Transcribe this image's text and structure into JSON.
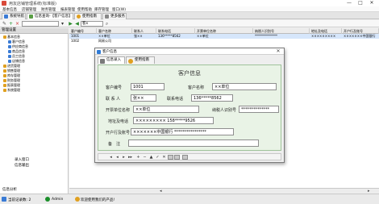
{
  "window": {
    "title": "用友店铺管理系统(标准版)",
    "min": "—",
    "max": "□",
    "close": "✕",
    "colors": {
      "app_icon": "#d94a3a"
    }
  },
  "menu": [
    "基本信息",
    "店铺管理",
    "财务管理",
    "报表管理",
    "使用帮助",
    "库存管理",
    "窗口(W)"
  ],
  "tabs": [
    {
      "label": "系统导航",
      "icon": "nav-icon",
      "color": "#3a7bd5"
    },
    {
      "label": "信息查询-【客户信息】",
      "icon": "doc-icon",
      "color": "#5a9e45"
    },
    {
      "label": "使用指南",
      "icon": "help-icon",
      "color": "#e0a020"
    },
    {
      "label": "更多服务",
      "icon": "more-icon",
      "color": "#888888"
    }
  ],
  "toolbar": {
    "icons": [
      "edit-icon",
      "add-icon",
      "delete-icon",
      "save-icon",
      "search-icon",
      "back-icon",
      "forward-icon"
    ],
    "search_value": "",
    "field_value": "客x"
  },
  "left_panel": {
    "header": "管理设置",
    "items": [
      {
        "label": "基本信息",
        "indent": 1,
        "color": "#e0a020"
      },
      {
        "label": "客户信息",
        "indent": 2,
        "color": "#3a7bd5"
      },
      {
        "label": "供应商信息",
        "indent": 2,
        "color": "#3a7bd5"
      },
      {
        "label": "商品信息",
        "indent": 2,
        "color": "#3a7bd5"
      },
      {
        "label": "员工信息",
        "indent": 2,
        "color": "#3a7bd5"
      },
      {
        "label": "店铺信息",
        "indent": 2,
        "color": "#3a7bd5"
      },
      {
        "label": "进货管理",
        "indent": 1,
        "color": "#e0a020"
      },
      {
        "label": "销售管理",
        "indent": 1,
        "color": "#e0a020"
      },
      {
        "label": "库存管理",
        "indent": 1,
        "color": "#e0a020"
      },
      {
        "label": "财务管理",
        "indent": 1,
        "color": "#e0a020"
      },
      {
        "label": "报表管理",
        "indent": 1,
        "color": "#e0a020"
      },
      {
        "label": "系统管理",
        "indent": 1,
        "color": "#e0a020"
      }
    ],
    "bottom_items": [
      "录入窗口",
      "信息输出"
    ],
    "footer": "信息分析"
  },
  "grid": {
    "columns": [
      "客户编号",
      "客户名称",
      "联系人",
      "联系电话",
      "开票单位名称",
      "纳税人识别号",
      "地址及电话",
      "开户行及账号"
    ],
    "rows": [
      [
        "1001",
        "××单位",
        "张××",
        "136*****8562",
        "××单位",
        "**************",
        "×××××××××",
        "×××××××中国银行"
      ],
      [
        "1002",
        "网易公司",
        "",
        "",
        "",
        "",
        "",
        ""
      ]
    ],
    "footer_arrows": [
      "◂",
      "▸"
    ]
  },
  "dialog": {
    "title": "客户信息",
    "close": "✕",
    "tabs": [
      {
        "label": "信息录入",
        "icon": "form-icon",
        "color": "#7a7a7a"
      },
      {
        "label": "使用指南",
        "icon": "help-icon",
        "color": "#e0a020"
      }
    ],
    "form_title": "客户信息",
    "fields": {
      "customer_id": {
        "label": "客户编号",
        "value": "1001"
      },
      "customer_name": {
        "label": "客户名称",
        "value": "××单位"
      },
      "contact": {
        "label": "联 系 人",
        "value": "张××"
      },
      "phone": {
        "label": "联系电话",
        "value": "136*****8562"
      },
      "invoice_name": {
        "label": "开票单位名称",
        "value": "××单位"
      },
      "tax_id": {
        "label": "纳税人识别号",
        "value": "**************"
      },
      "address": {
        "label": "地址及电话",
        "value": "×××××××××    158*****9526"
      },
      "bank": {
        "label": "开户行及账号",
        "value": "×××××××中国银行    ****************"
      },
      "remark": {
        "label": "备　注",
        "value": ""
      }
    },
    "nav": {
      "first": "◂",
      "prev": "◂",
      "next": "▸",
      "last": "▸▸",
      "add": "+",
      "delete": "−",
      "edit": "▲",
      "save": "✓",
      "cancel": "✕"
    }
  },
  "status": {
    "left": "当前记录数: 2",
    "user": "Admin",
    "message": "欢迎使用我们的产品!"
  }
}
